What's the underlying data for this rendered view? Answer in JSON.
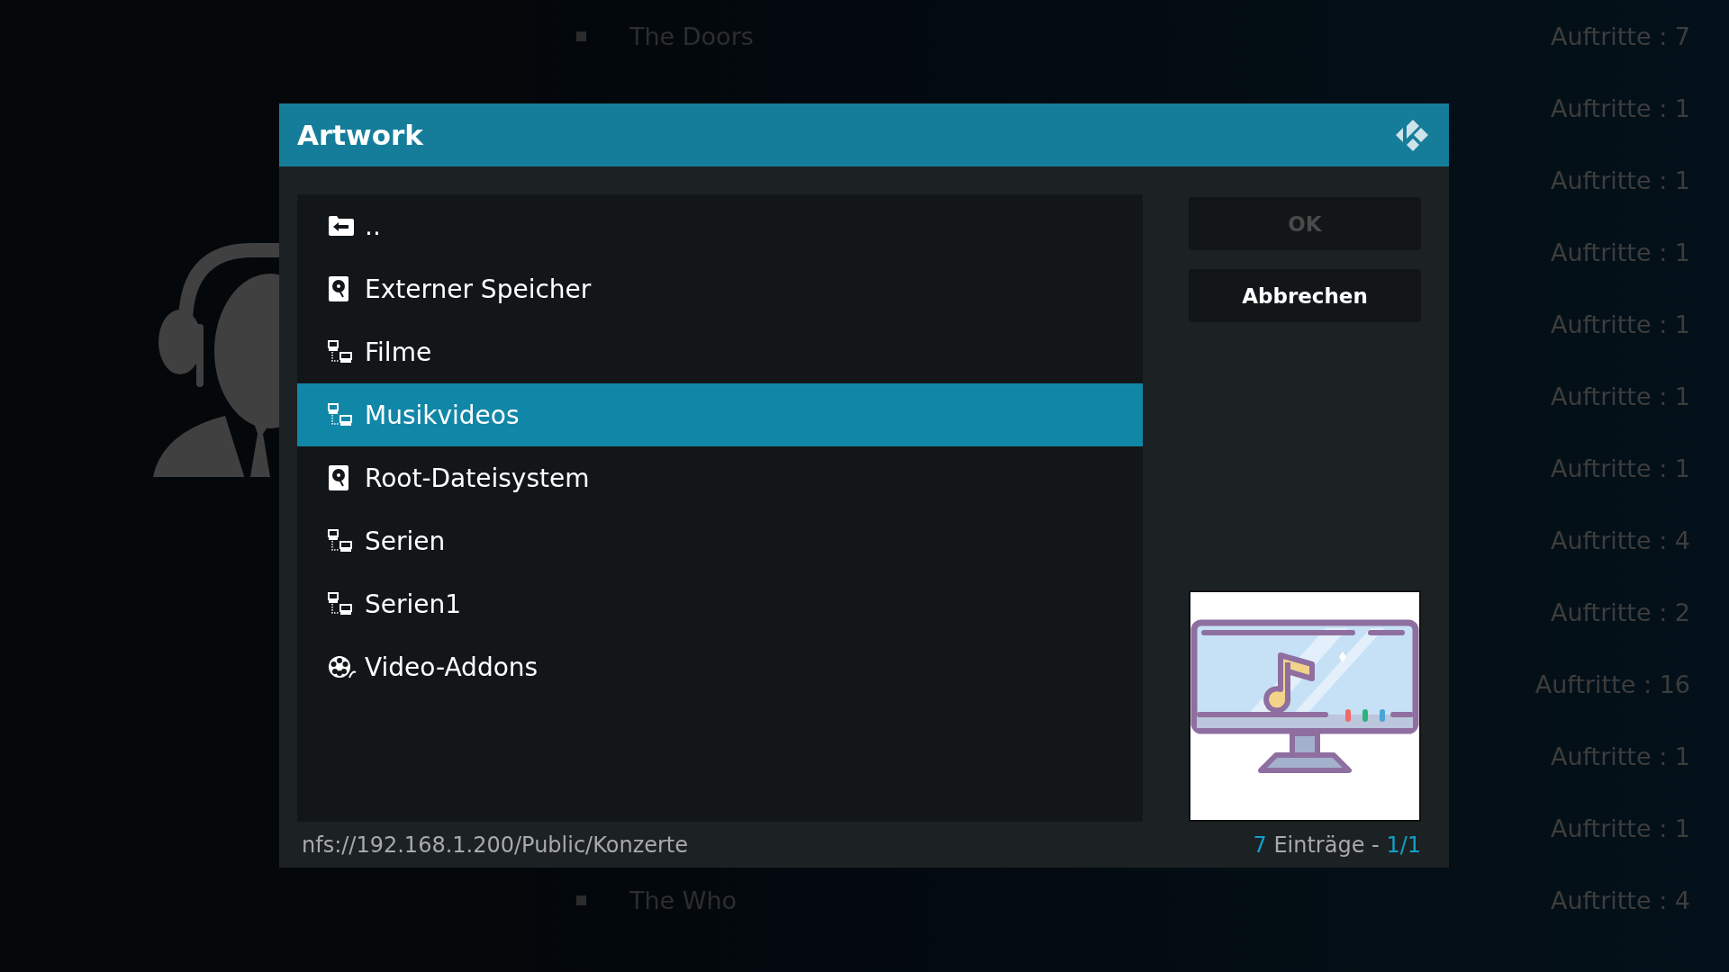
{
  "background_list": {
    "rows": [
      {
        "title": "The Doors",
        "count": "Auftritte : 7"
      },
      {
        "count": "Auftritte : 1"
      },
      {
        "count": "Auftritte : 1"
      },
      {
        "count": "Auftritte : 1"
      },
      {
        "count": "Auftritte : 1"
      },
      {
        "count": "Auftritte : 1"
      },
      {
        "count": "Auftritte : 1"
      },
      {
        "count": "Auftritte : 4"
      },
      {
        "count": "Auftritte : 2"
      },
      {
        "count": "Auftritte : 16"
      },
      {
        "count": "Auftritte : 1"
      },
      {
        "count": "Auftritte : 1"
      },
      {
        "title": "The Who",
        "count": "Auftritte : 4"
      }
    ]
  },
  "dialog": {
    "title": "Artwork",
    "items": [
      {
        "label": "..",
        "kind": "parent",
        "selected": false
      },
      {
        "label": "Externer Speicher",
        "kind": "drive",
        "selected": false
      },
      {
        "label": "Filme",
        "kind": "network",
        "selected": false
      },
      {
        "label": "Musikvideos",
        "kind": "network",
        "selected": true
      },
      {
        "label": "Root-Dateisystem",
        "kind": "drive",
        "selected": false
      },
      {
        "label": "Serien",
        "kind": "network",
        "selected": false
      },
      {
        "label": "Serien1",
        "kind": "network",
        "selected": false
      },
      {
        "label": "Video-Addons",
        "kind": "addons",
        "selected": false
      }
    ],
    "buttons": [
      {
        "label": "OK",
        "disabled": true
      },
      {
        "label": "Abbrechen",
        "disabled": false
      }
    ],
    "path": "nfs://192.168.1.200/Public/Konzerte",
    "item_count": "7",
    "count_label": "Einträge -",
    "page": "1/1"
  }
}
